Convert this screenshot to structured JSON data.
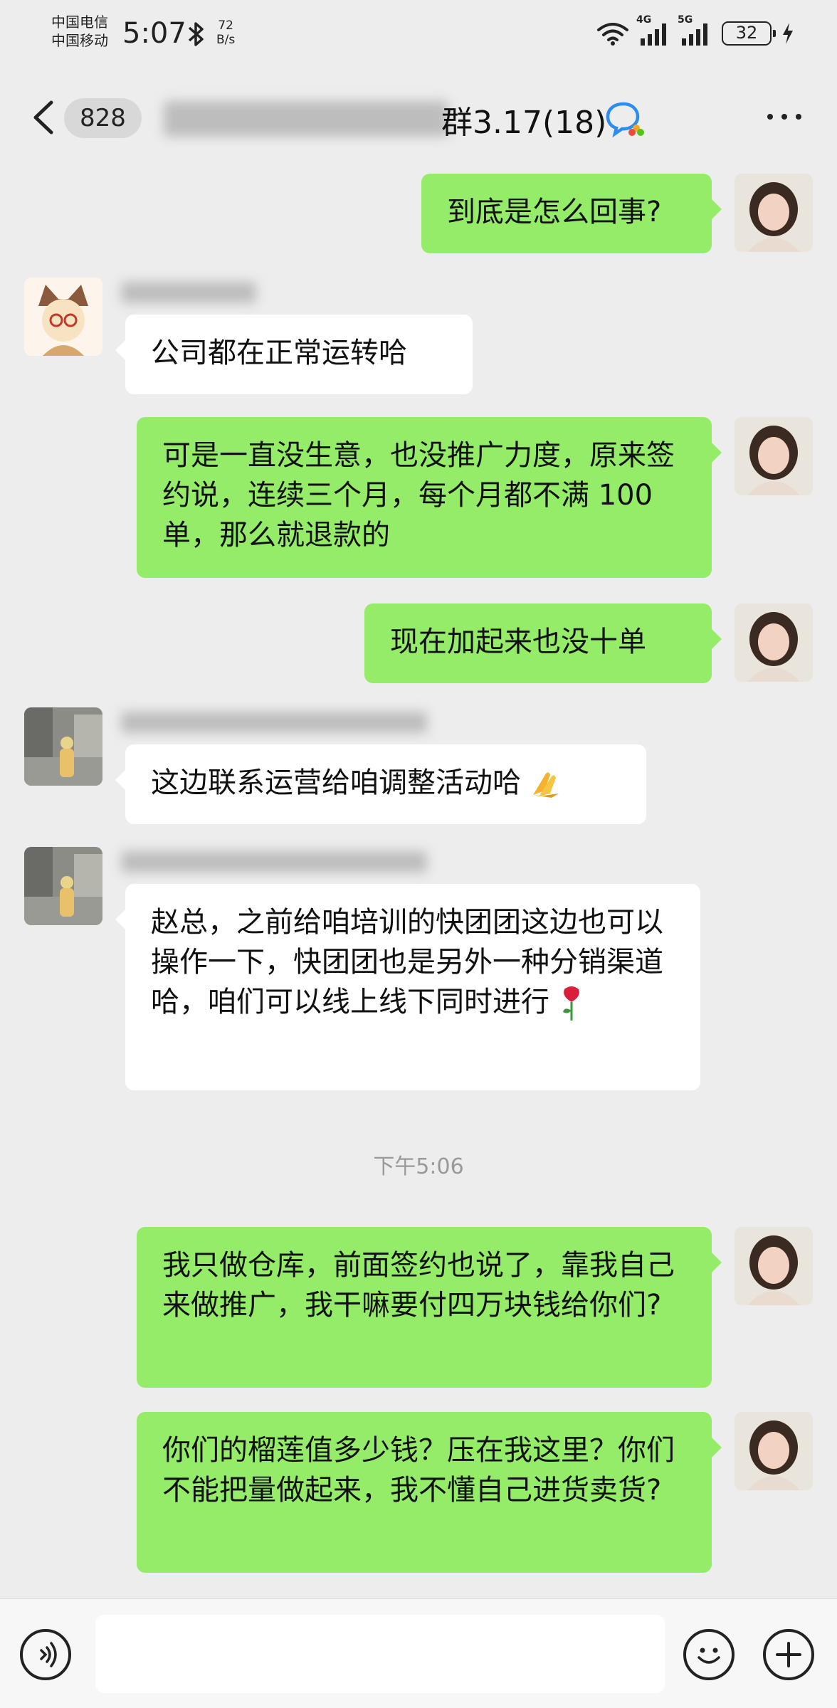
{
  "status_bar": {
    "carrier_1": "中国电信",
    "carrier_2": "中国移动",
    "time": "5:07",
    "net_speed_value": "72",
    "net_speed_unit": "B/s",
    "signal_1_label": "4G",
    "signal_2_label": "5G",
    "battery": "32"
  },
  "nav": {
    "unread_count": "828",
    "title_suffix": "群3.17(18)"
  },
  "messages": [
    {
      "side": "me",
      "text": "到底是怎么回事?"
    },
    {
      "side": "them",
      "text": "公司都在正常运转哈"
    },
    {
      "side": "me",
      "text": "可是一直没生意，也没推广力度，原来签约说，连续三个月，每个月都不满 100 单，那么就退款的"
    },
    {
      "side": "me",
      "text": "现在加起来也没十单"
    },
    {
      "side": "them",
      "text": "这边联系运营给咱调整活动哈"
    },
    {
      "side": "them",
      "text": "赵总，之前给咱培训的快团团这边也可以操作一下，快团团也是另外一种分销渠道哈，咱们可以线上线下同时进行"
    },
    {
      "side": "me",
      "text": "我只做仓库，前面签约也说了，靠我自己来做推广，我干嘛要付四万块钱给你们?"
    },
    {
      "side": "me",
      "text": "你们的榴莲值多少钱？压在我这里？你们不能把量做起来，我不懂自己进货卖货?"
    }
  ],
  "timestamp": "下午5:06",
  "colors": {
    "my_bubble": "#95ec69",
    "their_bubble": "#ffffff",
    "background": "#ededed"
  },
  "icons": {
    "back": "chevron-left-icon",
    "group": "group-chat-icon",
    "more": "more-dots-icon",
    "voice": "voice-icon",
    "emoji": "emoji-icon",
    "plus": "plus-icon",
    "praying_hands": "praying-hands-emoji",
    "rose": "rose-emoji"
  }
}
